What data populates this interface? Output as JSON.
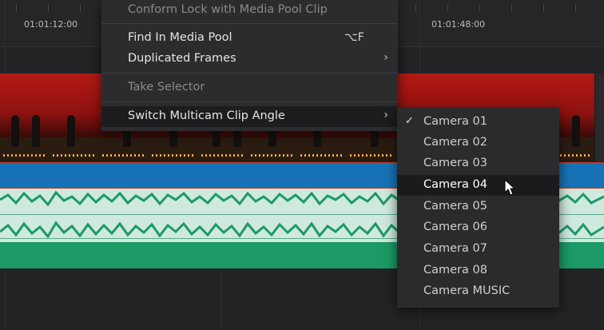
{
  "timeline": {
    "timecodes": [
      "01:01:12:00",
      "01:01:48:00"
    ]
  },
  "context_menu": {
    "items": [
      {
        "label": "Conform Lock with Media Pool Clip",
        "shortcut": "",
        "submenu": false,
        "state": "dimmed"
      },
      {
        "label": "Find In Media Pool",
        "shortcut": "⌥F",
        "submenu": false,
        "state": "normal"
      },
      {
        "label": "Duplicated Frames",
        "shortcut": "",
        "submenu": true,
        "state": "normal"
      },
      {
        "label": "Take Selector",
        "shortcut": "",
        "submenu": false,
        "state": "dimmed"
      },
      {
        "label": "Switch Multicam Clip Angle",
        "shortcut": "",
        "submenu": true,
        "state": "highlighted"
      }
    ],
    "arrow_glyph": "›"
  },
  "angle_submenu": {
    "items": [
      {
        "label": "Camera 01",
        "checked": true
      },
      {
        "label": "Camera 02",
        "checked": false
      },
      {
        "label": "Camera 03",
        "checked": false
      },
      {
        "label": "Camera 04",
        "checked": false,
        "hovered": true
      },
      {
        "label": "Camera 05",
        "checked": false
      },
      {
        "label": "Camera 06",
        "checked": false
      },
      {
        "label": "Camera 07",
        "checked": false
      },
      {
        "label": "Camera 08",
        "checked": false
      },
      {
        "label": "Camera MUSIC",
        "checked": false
      }
    ],
    "check_glyph": "✓"
  },
  "colors": {
    "video_clip_accent": "#c0392b",
    "clip_bar": "#1773b5",
    "audio_wave": "#1b9a65",
    "menu_bg": "#2c2c2f"
  }
}
